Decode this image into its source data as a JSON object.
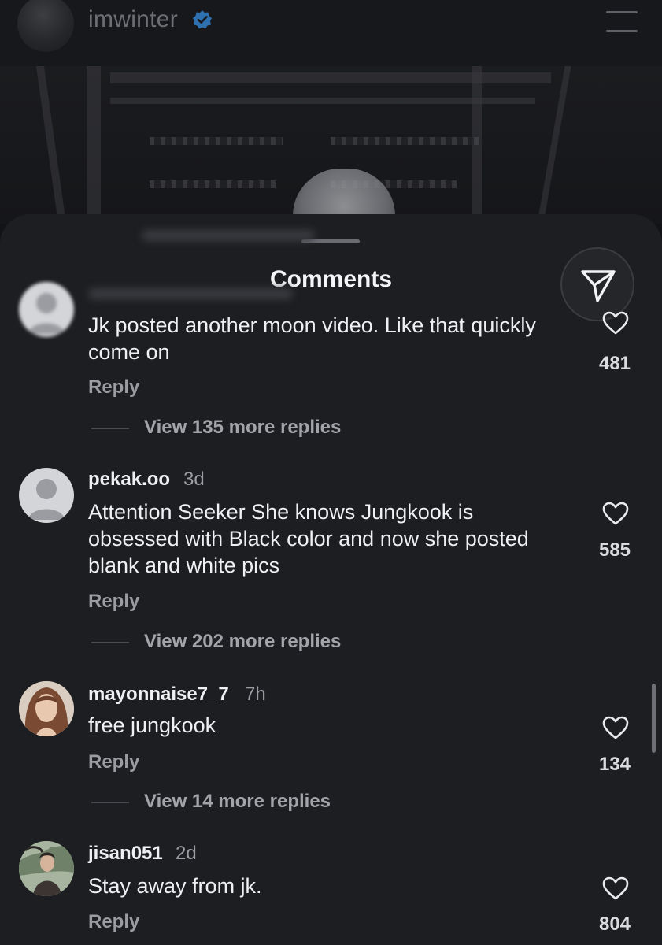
{
  "header": {
    "username": "imwinter",
    "verified": true,
    "icons": [
      "verified-badge-icon",
      "menu-icon"
    ]
  },
  "sheet": {
    "title": "Comments",
    "share_icon": "send-icon"
  },
  "colors": {
    "background": "#121316",
    "sheet": "#1d1e21",
    "verified": "#3a97f0",
    "muted_text": "#9b9da2"
  },
  "comments": [
    {
      "username": "",
      "time": "",
      "text": "Jk posted another moon video. Like that quickly come on",
      "reply_label": "Reply",
      "view_more": "View 135 more replies",
      "likes": "481"
    },
    {
      "username": "pekak.oo",
      "time": "3d",
      "text": "Attention Seeker She knows Jungkook is obsessed with Black color and now she posted blank and white pics",
      "reply_label": "Reply",
      "view_more": "View 202 more replies",
      "likes": "585"
    },
    {
      "username": "mayonnaise7_7",
      "time": "7h",
      "text": "free jungkook",
      "reply_label": "Reply",
      "view_more": "View 14 more replies",
      "likes": "134"
    },
    {
      "username": "jisan051",
      "time": "2d",
      "text": "Stay away from jk.",
      "reply_label": "Reply",
      "likes": "804"
    }
  ]
}
